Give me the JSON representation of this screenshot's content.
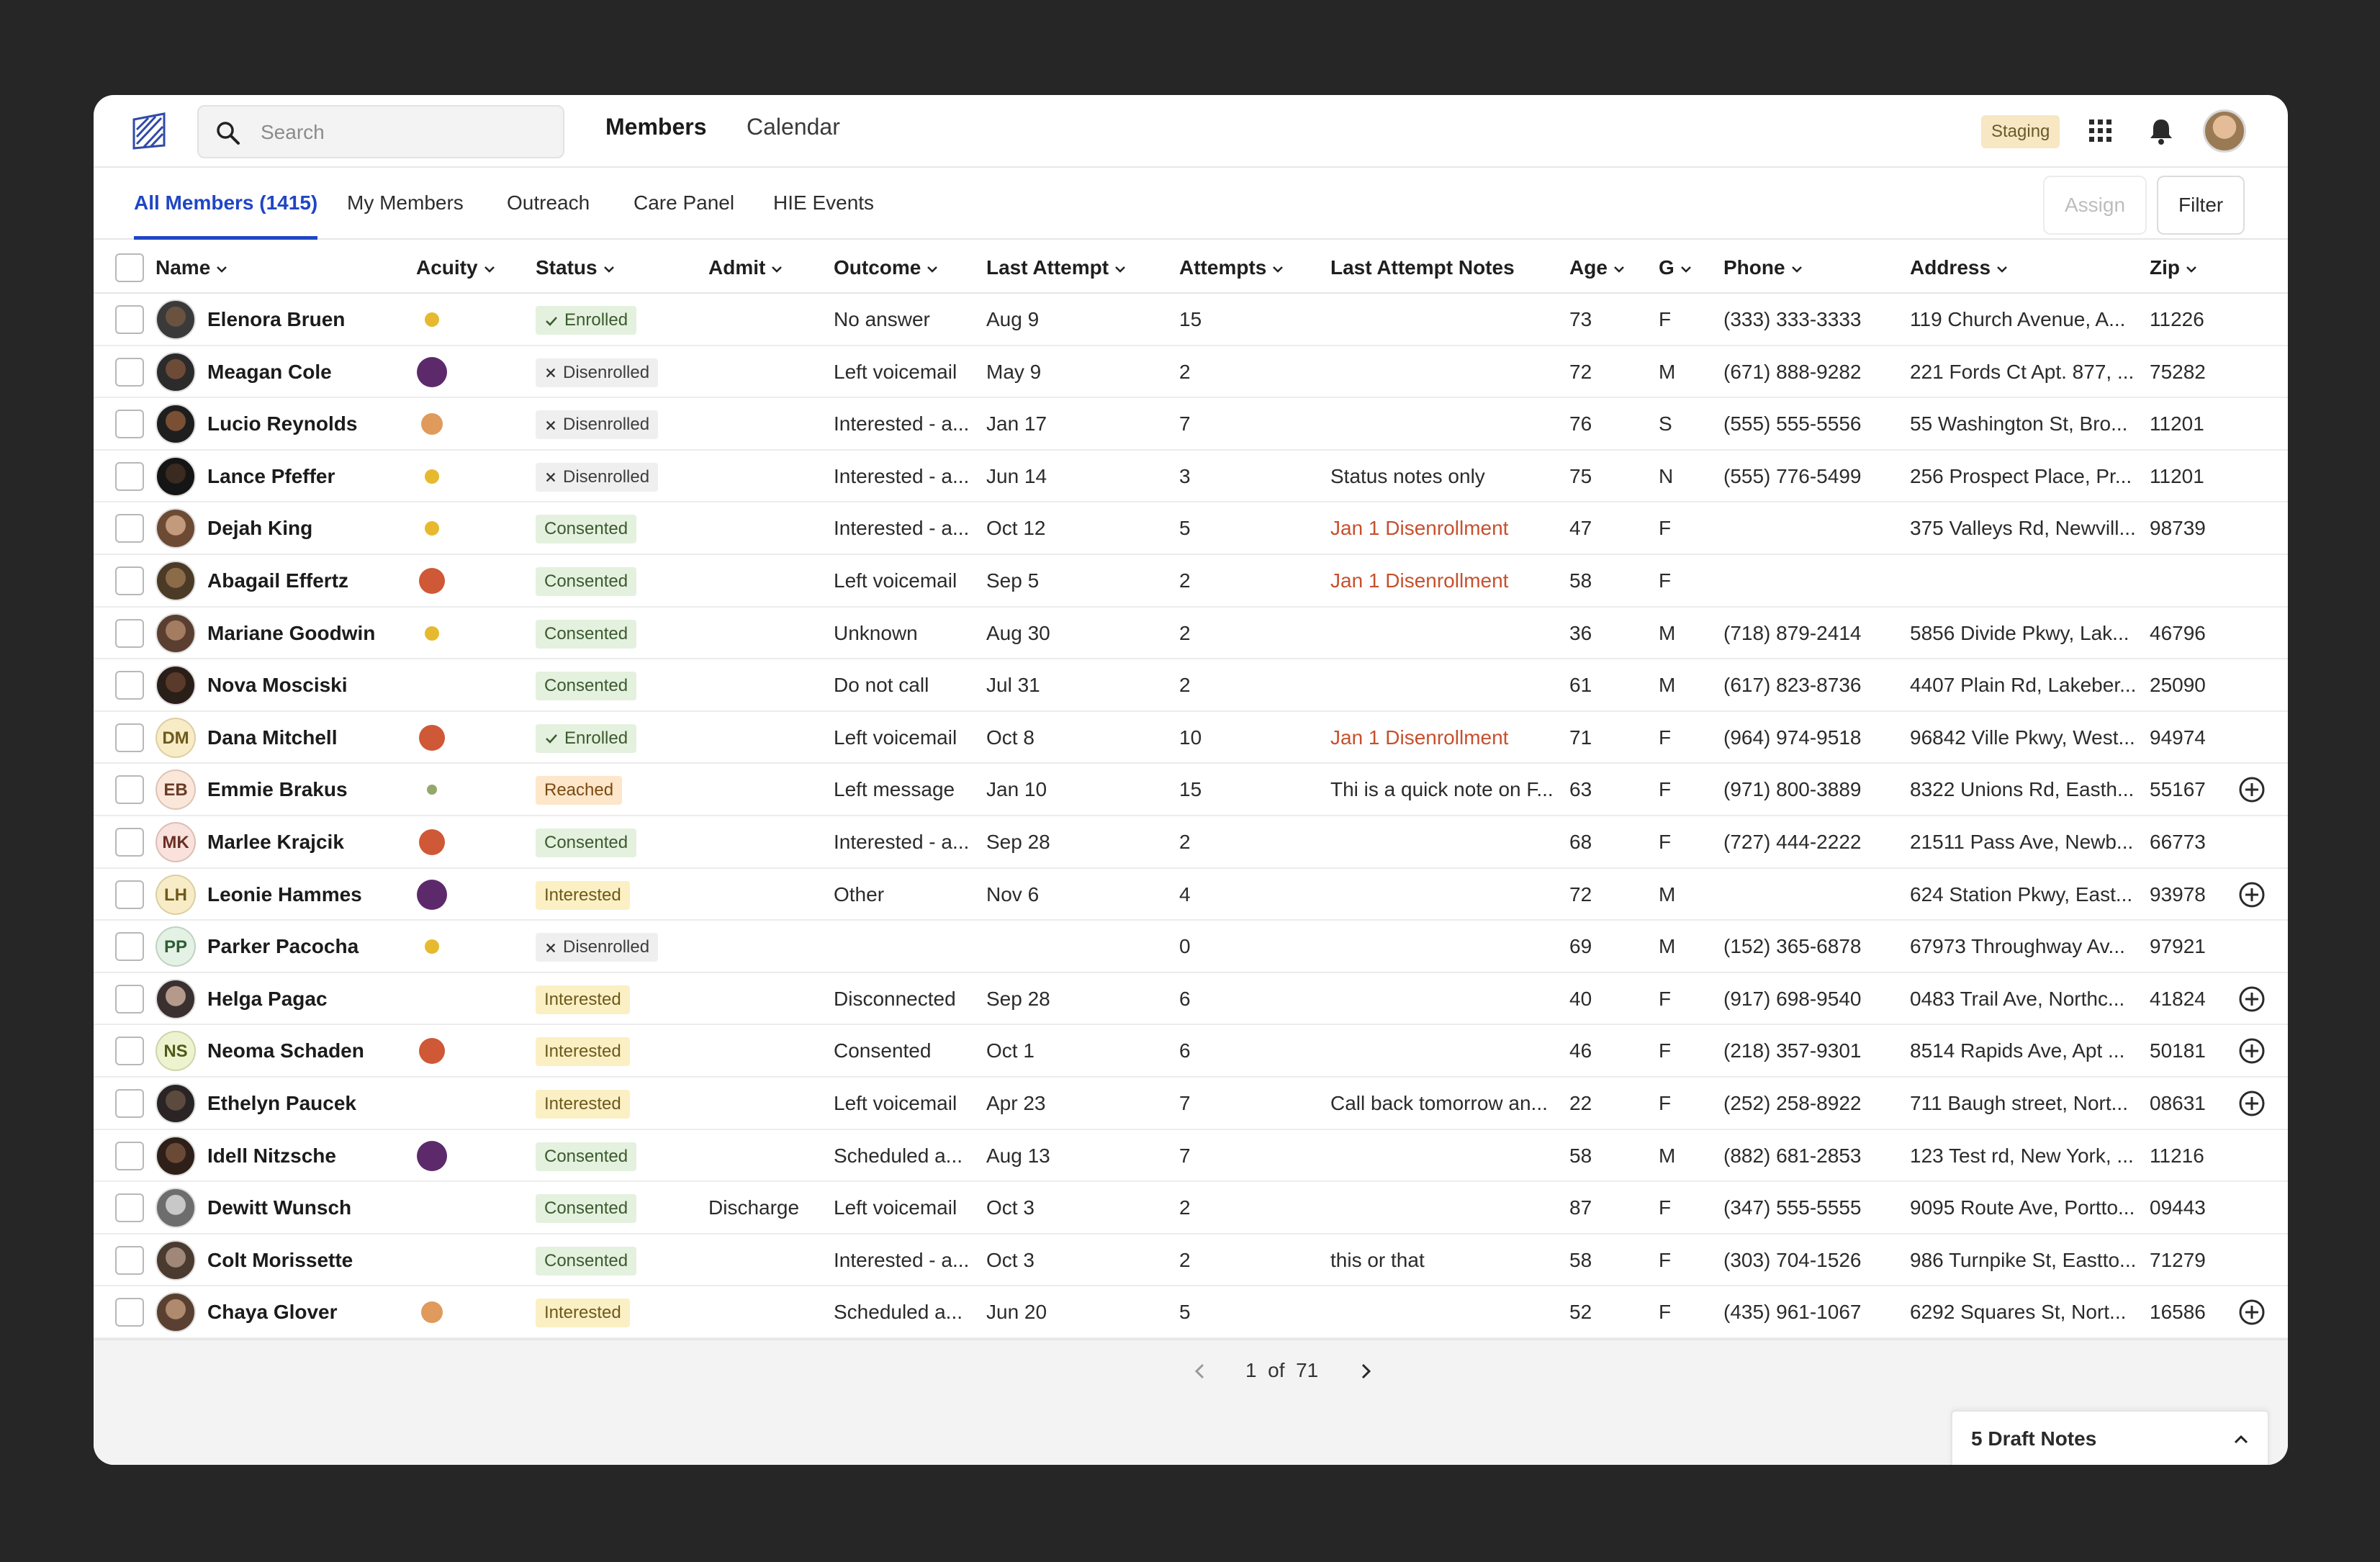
{
  "nav": {
    "search_placeholder": "Search",
    "links": [
      "Members",
      "Calendar"
    ],
    "env_badge": "Staging"
  },
  "tabs": [
    "All Members (1415)",
    "My Members",
    "Outreach",
    "Care Panel",
    "HIE Events"
  ],
  "actions": {
    "assign": "Assign",
    "filter": "Filter"
  },
  "columns": [
    "Name",
    "Acuity",
    "Status",
    "Admit",
    "Outcome",
    "Last Attempt",
    "Attempts",
    "Last Attempt Notes",
    "Age",
    "G",
    "Phone",
    "Address",
    "Zip"
  ],
  "colors": {
    "accent": "#2046c4",
    "note_red": "#c6502d",
    "acuity_yellow": "#e7b92e",
    "acuity_purple": "#5c2a6b",
    "acuity_orange": "#df9a5c",
    "acuity_red": "#cf5836",
    "acuity_green": "#94a86b"
  },
  "rows": [
    {
      "name": "Elenora Bruen",
      "avatar": "photo",
      "acuity": "yellow-sm",
      "status": "Enrolled",
      "status_type": "enrolled",
      "admit": "",
      "outcome": "No answer",
      "last_attempt": "Aug 9",
      "attempts": "15",
      "notes": "",
      "notes_red": false,
      "age": "73",
      "g": "F",
      "phone": "(333) 333-3333",
      "address": "119 Church Avenue, A...",
      "zip": "11226",
      "plus": false
    },
    {
      "name": "Meagan Cole",
      "avatar": "photo",
      "acuity": "purple-lg",
      "status": "Disenrolled",
      "status_type": "disenrolled",
      "admit": "",
      "outcome": "Left voicemail",
      "last_attempt": "May 9",
      "attempts": "2",
      "notes": "",
      "notes_red": false,
      "age": "72",
      "g": "M",
      "phone": "(671) 888-9282",
      "address": "221 Fords Ct Apt. 877, ...",
      "zip": "75282",
      "plus": false
    },
    {
      "name": "Lucio Reynolds",
      "avatar": "photo",
      "acuity": "orange-md",
      "status": "Disenrolled",
      "status_type": "disenrolled",
      "admit": "",
      "outcome": "Interested - a...",
      "last_attempt": "Jan 17",
      "attempts": "7",
      "notes": "",
      "notes_red": false,
      "age": "76",
      "g": "S",
      "phone": "(555) 555-5556",
      "address": "55 Washington St, Bro...",
      "zip": "11201",
      "plus": false
    },
    {
      "name": "Lance Pfeffer",
      "avatar": "photo",
      "acuity": "yellow-sm",
      "status": "Disenrolled",
      "status_type": "disenrolled",
      "admit": "",
      "outcome": "Interested - a...",
      "last_attempt": "Jun 14",
      "attempts": "3",
      "notes": "Status notes only",
      "notes_red": false,
      "age": "75",
      "g": "N",
      "phone": "(555) 776-5499",
      "address": "256 Prospect Place, Pr...",
      "zip": "11201",
      "plus": false
    },
    {
      "name": "Dejah King",
      "avatar": "photo",
      "acuity": "yellow-sm",
      "status": "Consented",
      "status_type": "consented",
      "admit": "",
      "outcome": "Interested - a...",
      "last_attempt": "Oct 12",
      "attempts": "5",
      "notes": "Jan 1 Disenrollment",
      "notes_red": true,
      "age": "47",
      "g": "F",
      "phone": "",
      "address": "375 Valleys Rd, Newvill...",
      "zip": "98739",
      "plus": false
    },
    {
      "name": "Abagail Effertz",
      "avatar": "photo",
      "acuity": "red-md",
      "status": "Consented",
      "status_type": "consented",
      "admit": "",
      "outcome": "Left voicemail",
      "last_attempt": "Sep 5",
      "attempts": "2",
      "notes": "Jan 1 Disenrollment",
      "notes_red": true,
      "age": "58",
      "g": "F",
      "phone": "",
      "address": "",
      "zip": "",
      "plus": false
    },
    {
      "name": "Mariane Goodwin",
      "avatar": "photo",
      "acuity": "yellow-sm",
      "status": "Consented",
      "status_type": "consented",
      "admit": "",
      "outcome": "Unknown",
      "last_attempt": "Aug 30",
      "attempts": "2",
      "notes": "",
      "notes_red": false,
      "age": "36",
      "g": "M",
      "phone": "(718) 879-2414",
      "address": "5856 Divide Pkwy, Lak...",
      "zip": "46796",
      "plus": false
    },
    {
      "name": "Nova Mosciski",
      "avatar": "photo",
      "acuity": "",
      "status": "Consented",
      "status_type": "consented",
      "admit": "",
      "outcome": "Do not call",
      "last_attempt": "Jul 31",
      "attempts": "2",
      "notes": "",
      "notes_red": false,
      "age": "61",
      "g": "M",
      "phone": "(617) 823-8736",
      "address": "4407 Plain Rd, Lakeber...",
      "zip": "25090",
      "plus": false
    },
    {
      "name": "Dana Mitchell",
      "avatar": "DM",
      "avatar_bg": "#f8ecc6",
      "avatar_fg": "#6d5a1d",
      "acuity": "red-md",
      "status": "Enrolled",
      "status_type": "enrolled",
      "admit": "",
      "outcome": "Left voicemail",
      "last_attempt": "Oct 8",
      "attempts": "10",
      "notes": "Jan 1 Disenrollment",
      "notes_red": true,
      "age": "71",
      "g": "F",
      "phone": "(964) 974-9518",
      "address": "96842 Ville Pkwy, West...",
      "zip": "94974",
      "plus": false
    },
    {
      "name": "Emmie Brakus",
      "avatar": "EB",
      "avatar_bg": "#fbe6da",
      "avatar_fg": "#6a3c26",
      "acuity": "green-xs",
      "status": "Reached",
      "status_type": "reached",
      "admit": "",
      "outcome": "Left message",
      "last_attempt": "Jan 10",
      "attempts": "15",
      "notes": "Thi is a quick note on F...",
      "notes_red": false,
      "age": "63",
      "g": "F",
      "phone": "(971) 800-3889",
      "address": "8322 Unions Rd, Easth...",
      "zip": "55167",
      "plus": true
    },
    {
      "name": "Marlee Krajcik",
      "avatar": "MK",
      "avatar_bg": "#f9e1dc",
      "avatar_fg": "#6a2f26",
      "acuity": "red-md",
      "status": "Consented",
      "status_type": "consented",
      "admit": "",
      "outcome": "Interested - a...",
      "last_attempt": "Sep 28",
      "attempts": "2",
      "notes": "",
      "notes_red": false,
      "age": "68",
      "g": "F",
      "phone": "(727) 444-2222",
      "address": "21511 Pass Ave, Newb...",
      "zip": "66773",
      "plus": false
    },
    {
      "name": "Leonie Hammes",
      "avatar": "LH",
      "avatar_bg": "#f8ecc6",
      "avatar_fg": "#6d5a1d",
      "acuity": "purple-lg",
      "status": "Interested",
      "status_type": "interested",
      "admit": "",
      "outcome": "Other",
      "last_attempt": "Nov 6",
      "attempts": "4",
      "notes": "",
      "notes_red": false,
      "age": "72",
      "g": "M",
      "phone": "",
      "address": "624 Station Pkwy, East...",
      "zip": "93978",
      "plus": true
    },
    {
      "name": "Parker Pacocha",
      "avatar": "PP",
      "avatar_bg": "#e3f2e4",
      "avatar_fg": "#2f5c35",
      "acuity": "yellow-sm",
      "status": "Disenrolled",
      "status_type": "disenrolled",
      "admit": "",
      "outcome": "",
      "last_attempt": "",
      "attempts": "0",
      "notes": "",
      "notes_red": false,
      "age": "69",
      "g": "M",
      "phone": "(152) 365-6878",
      "address": "67973 Throughway Av...",
      "zip": "97921",
      "plus": false
    },
    {
      "name": "Helga Pagac",
      "avatar": "photo",
      "acuity": "",
      "status": "Interested",
      "status_type": "interested",
      "admit": "",
      "outcome": "Disconnected",
      "last_attempt": "Sep 28",
      "attempts": "6",
      "notes": "",
      "notes_red": false,
      "age": "40",
      "g": "F",
      "phone": "(917) 698-9540",
      "address": "0483 Trail Ave, Northc...",
      "zip": "41824",
      "plus": true
    },
    {
      "name": "Neoma Schaden",
      "avatar": "NS",
      "avatar_bg": "#eef3cf",
      "avatar_fg": "#4e5a1a",
      "acuity": "red-md",
      "status": "Interested",
      "status_type": "interested",
      "admit": "",
      "outcome": "Consented",
      "last_attempt": "Oct 1",
      "attempts": "6",
      "notes": "",
      "notes_red": false,
      "age": "46",
      "g": "F",
      "phone": "(218) 357-9301",
      "address": "8514 Rapids Ave, Apt ...",
      "zip": "50181",
      "plus": true
    },
    {
      "name": "Ethelyn Paucek",
      "avatar": "photo",
      "acuity": "",
      "status": "Interested",
      "status_type": "interested",
      "admit": "",
      "outcome": "Left voicemail",
      "last_attempt": "Apr 23",
      "attempts": "7",
      "notes": "Call back tomorrow an...",
      "notes_red": false,
      "age": "22",
      "g": "F",
      "phone": "(252) 258-8922",
      "address": "711 Baugh street, Nort...",
      "zip": "08631",
      "plus": true
    },
    {
      "name": "Idell Nitzsche",
      "avatar": "photo",
      "acuity": "purple-lg",
      "status": "Consented",
      "status_type": "consented",
      "admit": "",
      "outcome": "Scheduled a...",
      "last_attempt": "Aug 13",
      "attempts": "7",
      "notes": "",
      "notes_red": false,
      "age": "58",
      "g": "M",
      "phone": "(882) 681-2853",
      "address": "123 Test rd, New York, ...",
      "zip": "11216",
      "plus": false
    },
    {
      "name": "Dewitt Wunsch",
      "avatar": "photo",
      "acuity": "",
      "status": "Consented",
      "status_type": "consented",
      "admit": "Discharge",
      "outcome": "Left voicemail",
      "last_attempt": "Oct 3",
      "attempts": "2",
      "notes": "",
      "notes_red": false,
      "age": "87",
      "g": "F",
      "phone": "(347) 555-5555",
      "address": "9095 Route Ave, Portto...",
      "zip": "09443",
      "plus": false
    },
    {
      "name": "Colt Morissette",
      "avatar": "photo",
      "acuity": "",
      "status": "Consented",
      "status_type": "consented",
      "admit": "",
      "outcome": "Interested - a...",
      "last_attempt": "Oct 3",
      "attempts": "2",
      "notes": "this or that",
      "notes_red": false,
      "age": "58",
      "g": "F",
      "phone": "(303) 704-1526",
      "address": "986 Turnpike St, Eastto...",
      "zip": "71279",
      "plus": false
    },
    {
      "name": "Chaya Glover",
      "avatar": "photo",
      "acuity": "orange-md",
      "status": "Interested",
      "status_type": "interested",
      "admit": "",
      "outcome": "Scheduled a...",
      "last_attempt": "Jun 20",
      "attempts": "5",
      "notes": "",
      "notes_red": false,
      "age": "52",
      "g": "F",
      "phone": "(435) 961-1067",
      "address": "6292 Squares St, Nort...",
      "zip": "16586",
      "plus": true
    }
  ],
  "pagination": {
    "current": "1",
    "of_label": "of",
    "total": "71"
  },
  "draft_notes": "5 Draft Notes"
}
